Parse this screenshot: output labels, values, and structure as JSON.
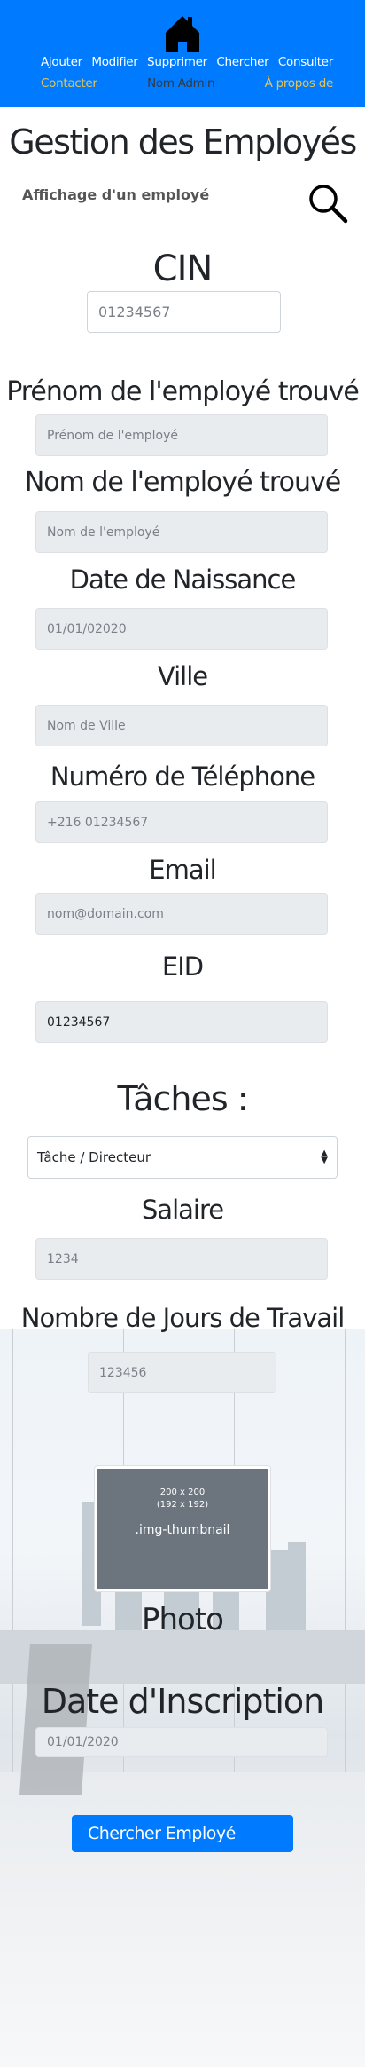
{
  "nav": {
    "links": [
      "Ajouter",
      "Modifier",
      "Supprimer",
      "Chercher",
      "Consulter"
    ],
    "contact": "Contacter",
    "admin": "Nom Admin",
    "about": "À propos de",
    "colors": {
      "bar": "#007bff",
      "accent": "#e5c454"
    }
  },
  "header": {
    "title": "Gestion des Employés",
    "subtitle": "Affichage d'un employé"
  },
  "fields": {
    "cin": {
      "label": "CIN",
      "value": "01234567"
    },
    "prenom": {
      "label": "Prénom de l'employé trouvé",
      "placeholder": "Prénom de l'employé"
    },
    "nom": {
      "label": "Nom de l'employé trouvé",
      "placeholder": "Nom de l'employé"
    },
    "naissance": {
      "label": "Date de Naissance",
      "placeholder": "01/01/02020"
    },
    "ville": {
      "label": "Ville",
      "placeholder": "Nom de Ville"
    },
    "tel": {
      "label": "Numéro de Téléphone",
      "placeholder": "+216 01234567"
    },
    "email": {
      "label": "Email",
      "placeholder": "nom@domain.com"
    },
    "eid": {
      "label": "EID",
      "value": "01234567"
    },
    "taches": {
      "label": "Tâches :",
      "selected": "Tâche / Directeur"
    },
    "salaire": {
      "label": "Salaire",
      "placeholder": "1234"
    },
    "jours": {
      "label": "Nombre de Jours de Travail",
      "placeholder": "123456"
    },
    "photo": {
      "label": "Photo",
      "thumb_line1": "200 x 200",
      "thumb_line2": "(192 x 192)",
      "thumb_line3": ".img-thumbnail"
    },
    "inscription": {
      "label": "Date d'Inscription",
      "placeholder": "01/01/2020"
    }
  },
  "submit": "Chercher Employé"
}
